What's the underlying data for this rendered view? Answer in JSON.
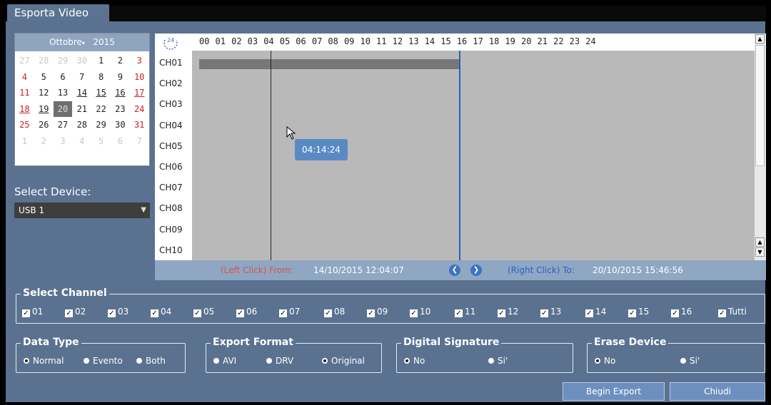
{
  "window": {
    "title": "Esporta Video"
  },
  "calendar": {
    "month": "Ottobre",
    "year": "2015",
    "weeks": [
      [
        {
          "d": "27",
          "c": "dim"
        },
        {
          "d": "28",
          "c": "dim"
        },
        {
          "d": "29",
          "c": "dim"
        },
        {
          "d": "30",
          "c": "dim"
        },
        {
          "d": "1",
          "c": ""
        },
        {
          "d": "2",
          "c": ""
        },
        {
          "d": "3",
          "c": "red"
        }
      ],
      [
        {
          "d": "4",
          "c": "red"
        },
        {
          "d": "5",
          "c": ""
        },
        {
          "d": "6",
          "c": ""
        },
        {
          "d": "7",
          "c": ""
        },
        {
          "d": "8",
          "c": ""
        },
        {
          "d": "9",
          "c": ""
        },
        {
          "d": "10",
          "c": "red"
        }
      ],
      [
        {
          "d": "11",
          "c": "red"
        },
        {
          "d": "12",
          "c": ""
        },
        {
          "d": "13",
          "c": ""
        },
        {
          "d": "14",
          "c": "u"
        },
        {
          "d": "15",
          "c": "u"
        },
        {
          "d": "16",
          "c": "u"
        },
        {
          "d": "17",
          "c": "red u"
        }
      ],
      [
        {
          "d": "18",
          "c": "red u"
        },
        {
          "d": "19",
          "c": "u"
        },
        {
          "d": "20",
          "c": "sel"
        },
        {
          "d": "21",
          "c": ""
        },
        {
          "d": "22",
          "c": ""
        },
        {
          "d": "23",
          "c": ""
        },
        {
          "d": "24",
          "c": "red"
        }
      ],
      [
        {
          "d": "25",
          "c": "red"
        },
        {
          "d": "26",
          "c": ""
        },
        {
          "d": "27",
          "c": ""
        },
        {
          "d": "28",
          "c": ""
        },
        {
          "d": "29",
          "c": ""
        },
        {
          "d": "30",
          "c": ""
        },
        {
          "d": "31",
          "c": "red"
        }
      ],
      [
        {
          "d": "1",
          "c": "dim"
        },
        {
          "d": "2",
          "c": "dim"
        },
        {
          "d": "3",
          "c": "dim"
        },
        {
          "d": "4",
          "c": "dim"
        },
        {
          "d": "5",
          "c": "dim"
        },
        {
          "d": "6",
          "c": "dim"
        },
        {
          "d": "7",
          "c": "dim"
        }
      ]
    ]
  },
  "device": {
    "label": "Select Device:",
    "value": "USB 1"
  },
  "timeline": {
    "icon_text": "24",
    "hours": [
      "00",
      "01",
      "02",
      "03",
      "04",
      "05",
      "06",
      "07",
      "08",
      "09",
      "10",
      "11",
      "12",
      "13",
      "14",
      "15",
      "16",
      "17",
      "18",
      "19",
      "20",
      "21",
      "22",
      "23",
      "24"
    ],
    "channels": [
      "CH01",
      "CH02",
      "CH03",
      "CH04",
      "CH05",
      "CH06",
      "CH07",
      "CH08",
      "CH09",
      "CH10"
    ],
    "recording_ch01_end_hour": 15.8,
    "from_hour": 4.07,
    "to_hour": 15.78,
    "tooltip": "04:14:24"
  },
  "range": {
    "from_label": "(Left Click) From:",
    "from_value": "14/10/2015 12:04:07",
    "to_label": "(Right Click) To:",
    "to_value": "20/10/2015 15:46:56"
  },
  "select_channel": {
    "title": "Select Channel",
    "items": [
      "01",
      "02",
      "03",
      "04",
      "05",
      "06",
      "07",
      "08",
      "09",
      "10",
      "11",
      "12",
      "13",
      "14",
      "15",
      "16",
      "Tutti"
    ]
  },
  "data_type": {
    "title": "Data Type",
    "options": [
      "Normal",
      "Evento",
      "Both"
    ],
    "selected": 0
  },
  "export_format": {
    "title": "Export Format",
    "options": [
      "AVI",
      "DRV",
      "Original"
    ],
    "selected": 2
  },
  "digital_signature": {
    "title": "Digital Signature",
    "options": [
      "No",
      "Si'"
    ],
    "selected": 0
  },
  "erase_device": {
    "title": "Erase Device",
    "options": [
      "No",
      "Si'"
    ],
    "selected": 0
  },
  "buttons": {
    "begin_export": "Begin Export",
    "close": "Chiudi"
  }
}
